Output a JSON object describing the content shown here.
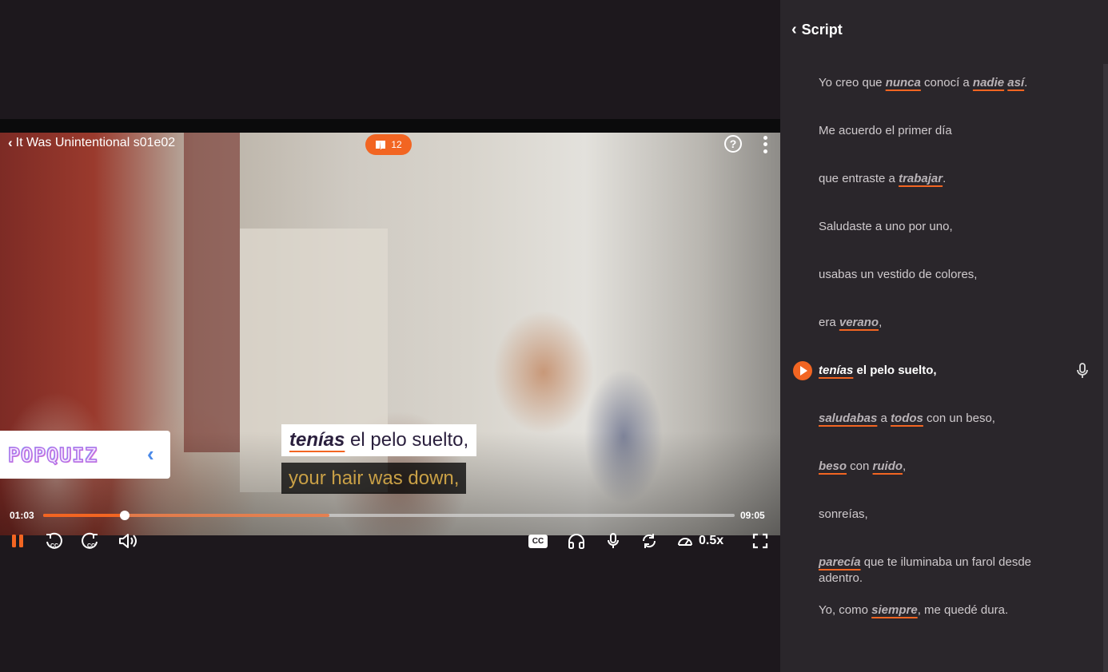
{
  "player": {
    "episode_title": "It Was Unintentional s01e02",
    "vocab_count": "12",
    "help_label": "?",
    "popquiz_logo": "POPQUIZ",
    "subtitle_es_rest": " el pelo suelto,",
    "subtitle_es_vocab": "tenías",
    "subtitle_en": "your hair was down,",
    "time_current": "01:03",
    "time_total": "09:05",
    "progress_played": 0.118,
    "progress_buffered": 0.414,
    "cc_label": "CC",
    "speed": "0.5x",
    "accent_color": "#f26522"
  },
  "icons": {
    "back": "chevron-left-icon",
    "vocab": "book-icon",
    "help": "help-circle-icon",
    "more": "more-vertical-icon",
    "pause": "pause-icon",
    "rewind_cc": "rewind-cc-icon",
    "forward_cc": "forward-cc-icon",
    "volume": "volume-icon",
    "headphones": "headphones-icon",
    "mic": "microphone-icon",
    "repeat": "repeat-icon",
    "speed": "speedometer-icon",
    "fullscreen": "fullscreen-icon"
  },
  "script": {
    "title": "Script",
    "lines": [
      {
        "parts": [
          {
            "t": "Yo creo que "
          },
          {
            "t": "nunca",
            "v": true
          },
          {
            "t": " conocí a "
          },
          {
            "t": "nadie",
            "v": true
          },
          {
            "t": " "
          },
          {
            "t": "así",
            "v": true
          },
          {
            "t": "."
          }
        ]
      },
      {
        "parts": [
          {
            "t": "Me acuerdo el primer día"
          }
        ]
      },
      {
        "parts": [
          {
            "t": "que entraste a "
          },
          {
            "t": "trabajar",
            "v": true
          },
          {
            "t": "."
          }
        ]
      },
      {
        "parts": [
          {
            "t": "Saludaste a uno por uno,"
          }
        ]
      },
      {
        "parts": [
          {
            "t": "usabas un vestido de colores,"
          }
        ]
      },
      {
        "parts": [
          {
            "t": "era "
          },
          {
            "t": "verano",
            "v": true
          },
          {
            "t": ","
          }
        ]
      },
      {
        "active": true,
        "parts": [
          {
            "t": "tenías",
            "v": true
          },
          {
            "t": " el pelo suelto,"
          }
        ]
      },
      {
        "parts": [
          {
            "t": "saludabas",
            "v": true
          },
          {
            "t": " a "
          },
          {
            "t": "todos",
            "v": true
          },
          {
            "t": " con un beso,"
          }
        ]
      },
      {
        "parts": [
          {
            "t": "beso",
            "v": true
          },
          {
            "t": " con "
          },
          {
            "t": "ruido",
            "v": true
          },
          {
            "t": ","
          }
        ]
      },
      {
        "parts": [
          {
            "t": "sonreías,"
          }
        ]
      },
      {
        "parts": [
          {
            "t": "parecía",
            "v": true
          },
          {
            "t": " que te iluminaba un farol desde adentro."
          }
        ]
      },
      {
        "parts": [
          {
            "t": "Yo, como "
          },
          {
            "t": "siempre",
            "v": true
          },
          {
            "t": ", me quedé dura."
          }
        ]
      }
    ]
  }
}
